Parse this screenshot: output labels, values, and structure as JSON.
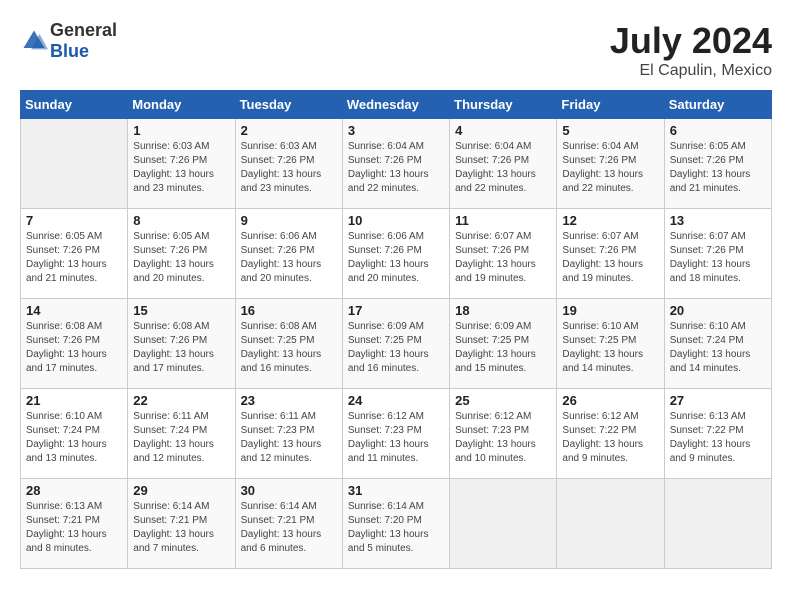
{
  "header": {
    "logo_general": "General",
    "logo_blue": "Blue",
    "month_year": "July 2024",
    "location": "El Capulin, Mexico"
  },
  "days_of_week": [
    "Sunday",
    "Monday",
    "Tuesday",
    "Wednesday",
    "Thursday",
    "Friday",
    "Saturday"
  ],
  "weeks": [
    [
      {
        "day": "",
        "sunrise": "",
        "sunset": "",
        "daylight": "",
        "empty": true
      },
      {
        "day": "1",
        "sunrise": "6:03 AM",
        "sunset": "7:26 PM",
        "daylight": "13 hours and 23 minutes."
      },
      {
        "day": "2",
        "sunrise": "6:03 AM",
        "sunset": "7:26 PM",
        "daylight": "13 hours and 23 minutes."
      },
      {
        "day": "3",
        "sunrise": "6:04 AM",
        "sunset": "7:26 PM",
        "daylight": "13 hours and 22 minutes."
      },
      {
        "day": "4",
        "sunrise": "6:04 AM",
        "sunset": "7:26 PM",
        "daylight": "13 hours and 22 minutes."
      },
      {
        "day": "5",
        "sunrise": "6:04 AM",
        "sunset": "7:26 PM",
        "daylight": "13 hours and 22 minutes."
      },
      {
        "day": "6",
        "sunrise": "6:05 AM",
        "sunset": "7:26 PM",
        "daylight": "13 hours and 21 minutes."
      }
    ],
    [
      {
        "day": "7",
        "sunrise": "6:05 AM",
        "sunset": "7:26 PM",
        "daylight": "13 hours and 21 minutes."
      },
      {
        "day": "8",
        "sunrise": "6:05 AM",
        "sunset": "7:26 PM",
        "daylight": "13 hours and 20 minutes."
      },
      {
        "day": "9",
        "sunrise": "6:06 AM",
        "sunset": "7:26 PM",
        "daylight": "13 hours and 20 minutes."
      },
      {
        "day": "10",
        "sunrise": "6:06 AM",
        "sunset": "7:26 PM",
        "daylight": "13 hours and 20 minutes."
      },
      {
        "day": "11",
        "sunrise": "6:07 AM",
        "sunset": "7:26 PM",
        "daylight": "13 hours and 19 minutes."
      },
      {
        "day": "12",
        "sunrise": "6:07 AM",
        "sunset": "7:26 PM",
        "daylight": "13 hours and 19 minutes."
      },
      {
        "day": "13",
        "sunrise": "6:07 AM",
        "sunset": "7:26 PM",
        "daylight": "13 hours and 18 minutes."
      }
    ],
    [
      {
        "day": "14",
        "sunrise": "6:08 AM",
        "sunset": "7:26 PM",
        "daylight": "13 hours and 17 minutes."
      },
      {
        "day": "15",
        "sunrise": "6:08 AM",
        "sunset": "7:26 PM",
        "daylight": "13 hours and 17 minutes."
      },
      {
        "day": "16",
        "sunrise": "6:08 AM",
        "sunset": "7:25 PM",
        "daylight": "13 hours and 16 minutes."
      },
      {
        "day": "17",
        "sunrise": "6:09 AM",
        "sunset": "7:25 PM",
        "daylight": "13 hours and 16 minutes."
      },
      {
        "day": "18",
        "sunrise": "6:09 AM",
        "sunset": "7:25 PM",
        "daylight": "13 hours and 15 minutes."
      },
      {
        "day": "19",
        "sunrise": "6:10 AM",
        "sunset": "7:25 PM",
        "daylight": "13 hours and 14 minutes."
      },
      {
        "day": "20",
        "sunrise": "6:10 AM",
        "sunset": "7:24 PM",
        "daylight": "13 hours and 14 minutes."
      }
    ],
    [
      {
        "day": "21",
        "sunrise": "6:10 AM",
        "sunset": "7:24 PM",
        "daylight": "13 hours and 13 minutes."
      },
      {
        "day": "22",
        "sunrise": "6:11 AM",
        "sunset": "7:24 PM",
        "daylight": "13 hours and 12 minutes."
      },
      {
        "day": "23",
        "sunrise": "6:11 AM",
        "sunset": "7:23 PM",
        "daylight": "13 hours and 12 minutes."
      },
      {
        "day": "24",
        "sunrise": "6:12 AM",
        "sunset": "7:23 PM",
        "daylight": "13 hours and 11 minutes."
      },
      {
        "day": "25",
        "sunrise": "6:12 AM",
        "sunset": "7:23 PM",
        "daylight": "13 hours and 10 minutes."
      },
      {
        "day": "26",
        "sunrise": "6:12 AM",
        "sunset": "7:22 PM",
        "daylight": "13 hours and 9 minutes."
      },
      {
        "day": "27",
        "sunrise": "6:13 AM",
        "sunset": "7:22 PM",
        "daylight": "13 hours and 9 minutes."
      }
    ],
    [
      {
        "day": "28",
        "sunrise": "6:13 AM",
        "sunset": "7:21 PM",
        "daylight": "13 hours and 8 minutes."
      },
      {
        "day": "29",
        "sunrise": "6:14 AM",
        "sunset": "7:21 PM",
        "daylight": "13 hours and 7 minutes."
      },
      {
        "day": "30",
        "sunrise": "6:14 AM",
        "sunset": "7:21 PM",
        "daylight": "13 hours and 6 minutes."
      },
      {
        "day": "31",
        "sunrise": "6:14 AM",
        "sunset": "7:20 PM",
        "daylight": "13 hours and 5 minutes."
      },
      {
        "day": "",
        "sunrise": "",
        "sunset": "",
        "daylight": "",
        "empty": true
      },
      {
        "day": "",
        "sunrise": "",
        "sunset": "",
        "daylight": "",
        "empty": true
      },
      {
        "day": "",
        "sunrise": "",
        "sunset": "",
        "daylight": "",
        "empty": true
      }
    ]
  ]
}
